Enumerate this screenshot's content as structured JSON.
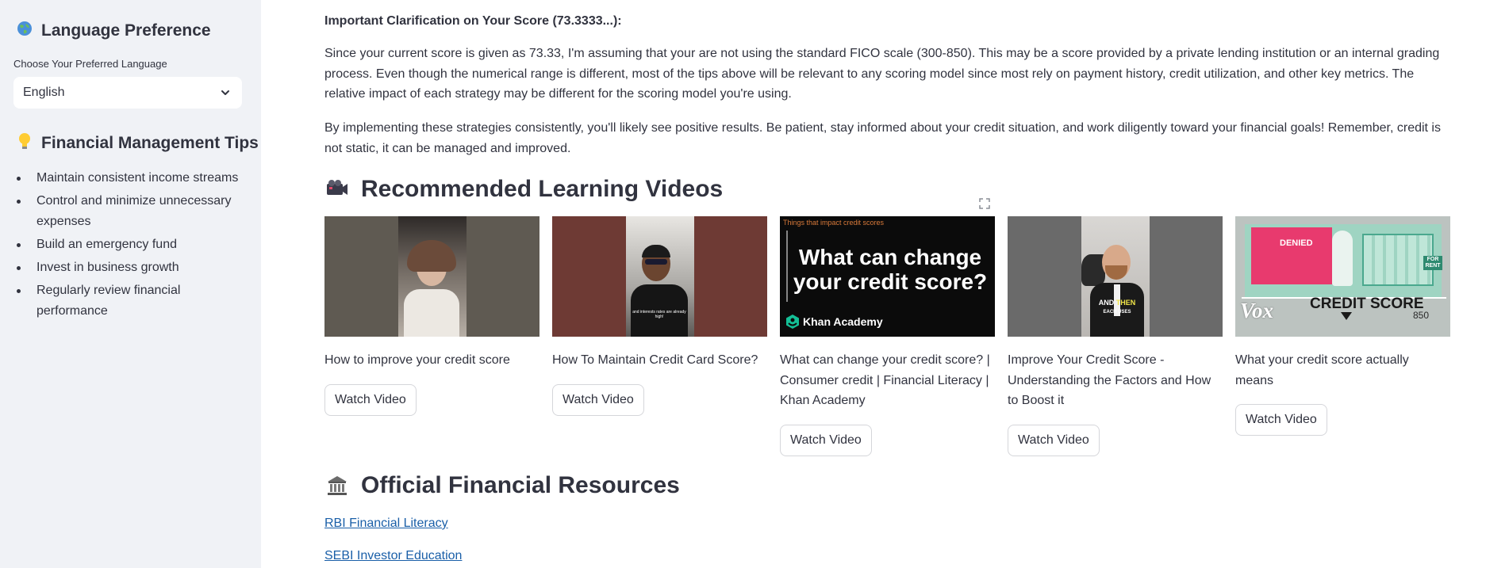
{
  "sidebar": {
    "language": {
      "header": "Language Preference",
      "header_icon": "globe-icon",
      "label": "Choose Your Preferred Language",
      "selected": "English"
    },
    "tips": {
      "header": "Financial Management Tips",
      "header_icon": "lightbulb-icon",
      "items": [
        "Maintain consistent income streams",
        "Control and minimize unnecessary expenses",
        "Build an emergency fund",
        "Invest in business growth",
        "Regularly review financial performance"
      ]
    }
  },
  "main": {
    "clarification_title": "Important Clarification on Your Score (73.3333...):",
    "paragraph1": "Since your current score is given as 73.33, I'm assuming that your are not using the standard FICO scale (300-850). This may be a score provided by a private lending institution or an internal grading process. Even though the numerical range is different, most of the tips above will be relevant to any scoring model since most rely on payment history, credit utilization, and other key metrics. The relative impact of each strategy may be different for the scoring model you're using.",
    "paragraph2": "By implementing these strategies consistently, you'll likely see positive results. Be patient, stay informed about your credit situation, and work diligently toward your financial goals! Remember, credit is not static, it can be managed and improved.",
    "videos_header": "Recommended Learning Videos",
    "videos_icon": "film-projector-icon",
    "watch_label": "Watch Video",
    "videos": [
      {
        "title": "How to improve your credit score"
      },
      {
        "title": "How To Maintain Credit Card Score?",
        "caption": "and interests rates are already high!"
      },
      {
        "title": "What can change your credit score? | Consumer credit | Financial Literacy | Khan Academy",
        "overlay_small": "Things that impact credit scores",
        "overlay_big": "What can change your credit score?",
        "brand": "Khan Academy"
      },
      {
        "title": "Improve Your Credit Score - Understanding the Factors and How to Boost it",
        "caption_a": "AND",
        "caption_b": "THEN",
        "caption_c": "EACH USES"
      },
      {
        "title": "What your credit score actually means",
        "stamp": "DENIED",
        "banner": "CREDIT SCORE",
        "brand": "Vox",
        "num": "850",
        "sign": "FOR RENT"
      }
    ],
    "resources_header": "Official Financial Resources",
    "resources_icon": "bank-building-icon",
    "links": [
      "RBI Financial Literacy",
      "SEBI Investor Education"
    ]
  },
  "colors": {
    "sidebar_bg": "#f0f2f6",
    "text": "#31333f",
    "link": "#1a5fa8"
  }
}
